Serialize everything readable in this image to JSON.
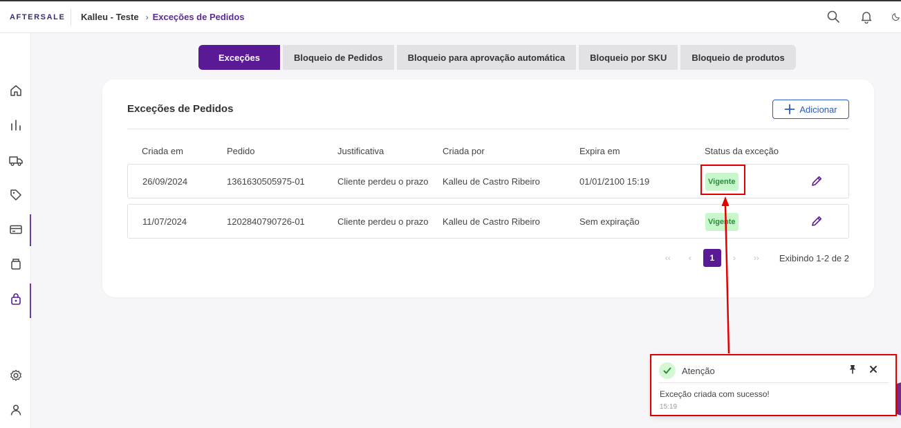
{
  "brand": "AFTERSALE",
  "breadcrumb": {
    "store": "Kalleu - Teste",
    "separator": "›",
    "page": "Exceções de Pedidos"
  },
  "topbar_icons": [
    "search-icon",
    "bell-icon",
    "moon-icon"
  ],
  "sidebar_icons": [
    "home-icon",
    "bar-chart-icon",
    "truck-icon",
    "tag-icon",
    "credit-card-icon",
    "box-icon",
    "lock-bag-icon",
    "settings-icon",
    "user-icon"
  ],
  "tabs": [
    {
      "label": "Exceções",
      "active": true
    },
    {
      "label": "Bloqueio de Pedidos",
      "active": false
    },
    {
      "label": "Bloqueio para aprovação automática",
      "active": false
    },
    {
      "label": "Bloqueio por SKU",
      "active": false
    },
    {
      "label": "Bloqueio de produtos",
      "active": false
    }
  ],
  "card": {
    "title": "Exceções de Pedidos",
    "add_label": "Adicionar"
  },
  "table": {
    "headers": [
      "Criada em",
      "Pedido",
      "Justificativa",
      "Criada por",
      "Expira em",
      "Status da exceção"
    ],
    "rows": [
      {
        "created": "26/09/2024",
        "order": "1361630505975-01",
        "reason": "Cliente perdeu o prazo",
        "by": "Kalleu de Castro Ribeiro",
        "expires": "01/01/2100 15:19",
        "status": "Vigente"
      },
      {
        "created": "11/07/2024",
        "order": "1202840790726-01",
        "reason": "Cliente perdeu o prazo",
        "by": "Kalleu de Castro Ribeiro",
        "expires": "Sem expiração",
        "status": "Vigente"
      }
    ]
  },
  "pagination": {
    "first": "‹‹",
    "prev": "‹",
    "current": "1",
    "next": "›",
    "last": "››",
    "info": "Exibindo 1-2 de 2"
  },
  "toast": {
    "title": "Atenção",
    "message": "Exceção criada com sucesso!",
    "time": "15:19"
  },
  "colors": {
    "primary": "#5a1a96",
    "success_bg": "#c9f7cc",
    "success_text": "#2a8b3c",
    "annotation": "#e00000",
    "link": "#2a58c6"
  }
}
